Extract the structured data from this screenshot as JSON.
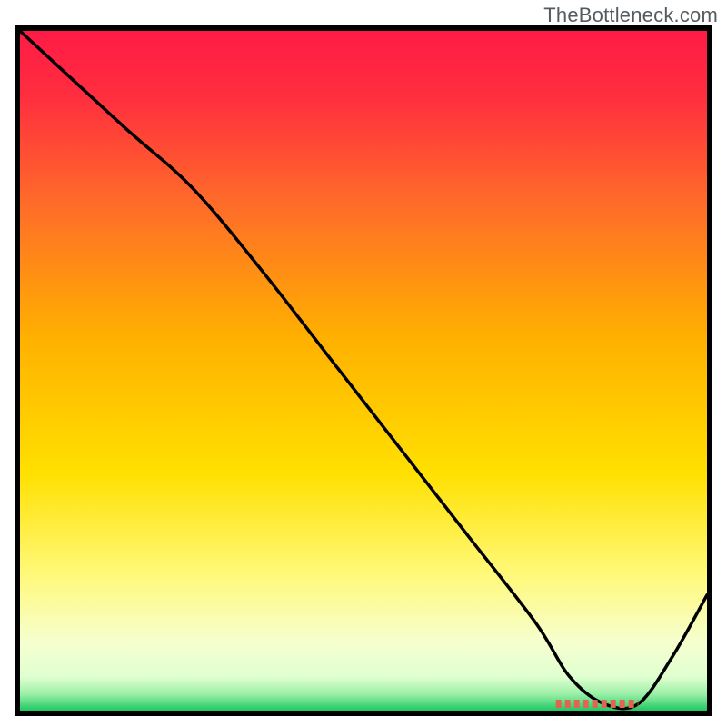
{
  "watermark": "TheBottleneck.com",
  "chart_data": {
    "type": "line",
    "title": "",
    "xlabel": "",
    "ylabel": "",
    "xlim": [
      0,
      100
    ],
    "ylim": [
      0,
      100
    ],
    "series": [
      {
        "name": "curve",
        "x": [
          0,
          15,
          25,
          35,
          45,
          55,
          65,
          75,
          80,
          85,
          90,
          95,
          100
        ],
        "values": [
          100,
          86,
          77,
          65,
          52,
          39,
          26,
          13,
          5,
          1,
          1,
          8,
          17
        ]
      }
    ],
    "gradient_stops": [
      {
        "offset": 0.0,
        "color": "#ff1a46"
      },
      {
        "offset": 0.1,
        "color": "#ff2f3e"
      },
      {
        "offset": 0.25,
        "color": "#ff6a2a"
      },
      {
        "offset": 0.45,
        "color": "#ffb000"
      },
      {
        "offset": 0.65,
        "color": "#ffe000"
      },
      {
        "offset": 0.8,
        "color": "#fff97a"
      },
      {
        "offset": 0.9,
        "color": "#f6ffcf"
      },
      {
        "offset": 0.95,
        "color": "#e0ffd0"
      },
      {
        "offset": 0.975,
        "color": "#9ef0a8"
      },
      {
        "offset": 1.0,
        "color": "#1ec964"
      }
    ],
    "optimal_marker": {
      "x_start": 78,
      "x_end": 90,
      "y": 1,
      "color": "#e06450"
    },
    "frame": {
      "stroke": "#000000",
      "stroke_width": 6
    },
    "curve_style": {
      "stroke": "#000000",
      "stroke_width": 3.5
    }
  }
}
